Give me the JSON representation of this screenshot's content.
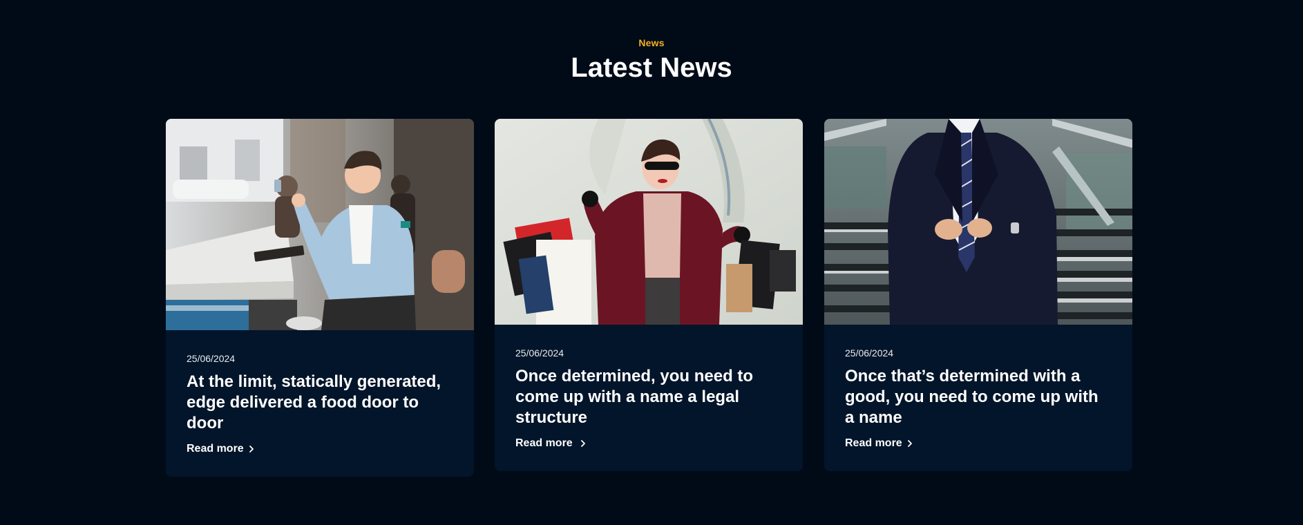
{
  "section": {
    "eyebrow": "News",
    "title": "Latest News"
  },
  "articles": [
    {
      "image_subject": "man-smiling-with-phone-at-cafe",
      "date": "25/06/2024",
      "title": "At the limit, statically generated, edge delivered a food door to door",
      "read_more": "Read more",
      "read_more_icon": "chevron-right-icon"
    },
    {
      "image_subject": "woman-with-shopping-bags",
      "date": "25/06/2024",
      "title": "Once determined, you need to come up with a name a legal structure",
      "read_more": "Read more",
      "read_more_icon": "chevron-right-icon"
    },
    {
      "image_subject": "businessman-in-suit-on-stairs",
      "date": "25/06/2024",
      "title": "Once that’s determined with a good, you need to come up with a name",
      "read_more": "Read more",
      "read_more_icon": "chevron-right-icon"
    }
  ],
  "colors": {
    "page_background": "#010b18",
    "card_background": "#03152a",
    "eyebrow_accent": "#f5b01f",
    "text": "#ffffff"
  }
}
